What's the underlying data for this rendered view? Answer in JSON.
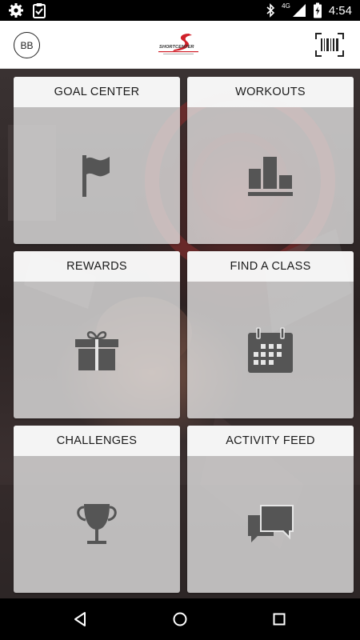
{
  "status_bar": {
    "time": "4:54",
    "network": "4G",
    "icons": [
      "settings-icon",
      "clipboard-check-icon",
      "bluetooth-icon",
      "signal-icon",
      "battery-charging-icon"
    ]
  },
  "header": {
    "avatar_initials": "BB",
    "logo_text": "SHORTCENTER",
    "logo_icon": "club-logo",
    "barcode_icon": "barcode-scan-icon"
  },
  "tiles": [
    {
      "label": "GOAL CENTER",
      "icon": "flag-icon"
    },
    {
      "label": "WORKOUTS",
      "icon": "bar-chart-icon"
    },
    {
      "label": "REWARDS",
      "icon": "gift-icon"
    },
    {
      "label": "FIND A CLASS",
      "icon": "calendar-icon"
    },
    {
      "label": "CHALLENGES",
      "icon": "trophy-icon"
    },
    {
      "label": "ACTIVITY FEED",
      "icon": "chat-bubbles-icon"
    }
  ],
  "nav_bar": {
    "icons": [
      "back-icon",
      "home-icon",
      "recents-icon"
    ]
  },
  "colors": {
    "tile_bg": "#e6e6e6",
    "tile_header_bg": "#f8f8f8",
    "icon_color": "#555555",
    "accent_red": "#d0202a"
  }
}
